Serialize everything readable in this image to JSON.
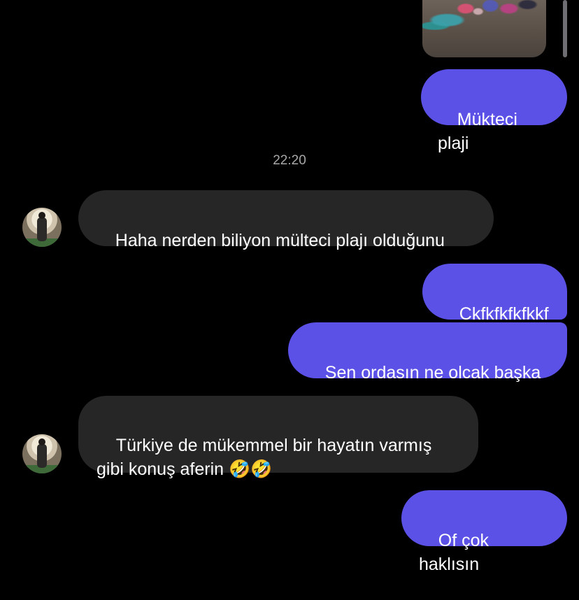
{
  "colors": {
    "background": "#000000",
    "outgoing_bubble": "#5b51e7",
    "incoming_bubble": "#262626",
    "timestamp_text": "#a8a8a8"
  },
  "messages": {
    "m1": "Mükteci plaji",
    "timestamp": "22:20",
    "m2": "Haha nerden biliyon mülteci plajı olduğunu",
    "m3": "Ckfkfkfkfkkf",
    "m4": "Sen ordasın ne olcak başka",
    "m5": "Türkiye de mükemmel bir hayatın varmış\ngibi konuş aferin 🤣🤣",
    "m6": "Of çok haklısın"
  }
}
